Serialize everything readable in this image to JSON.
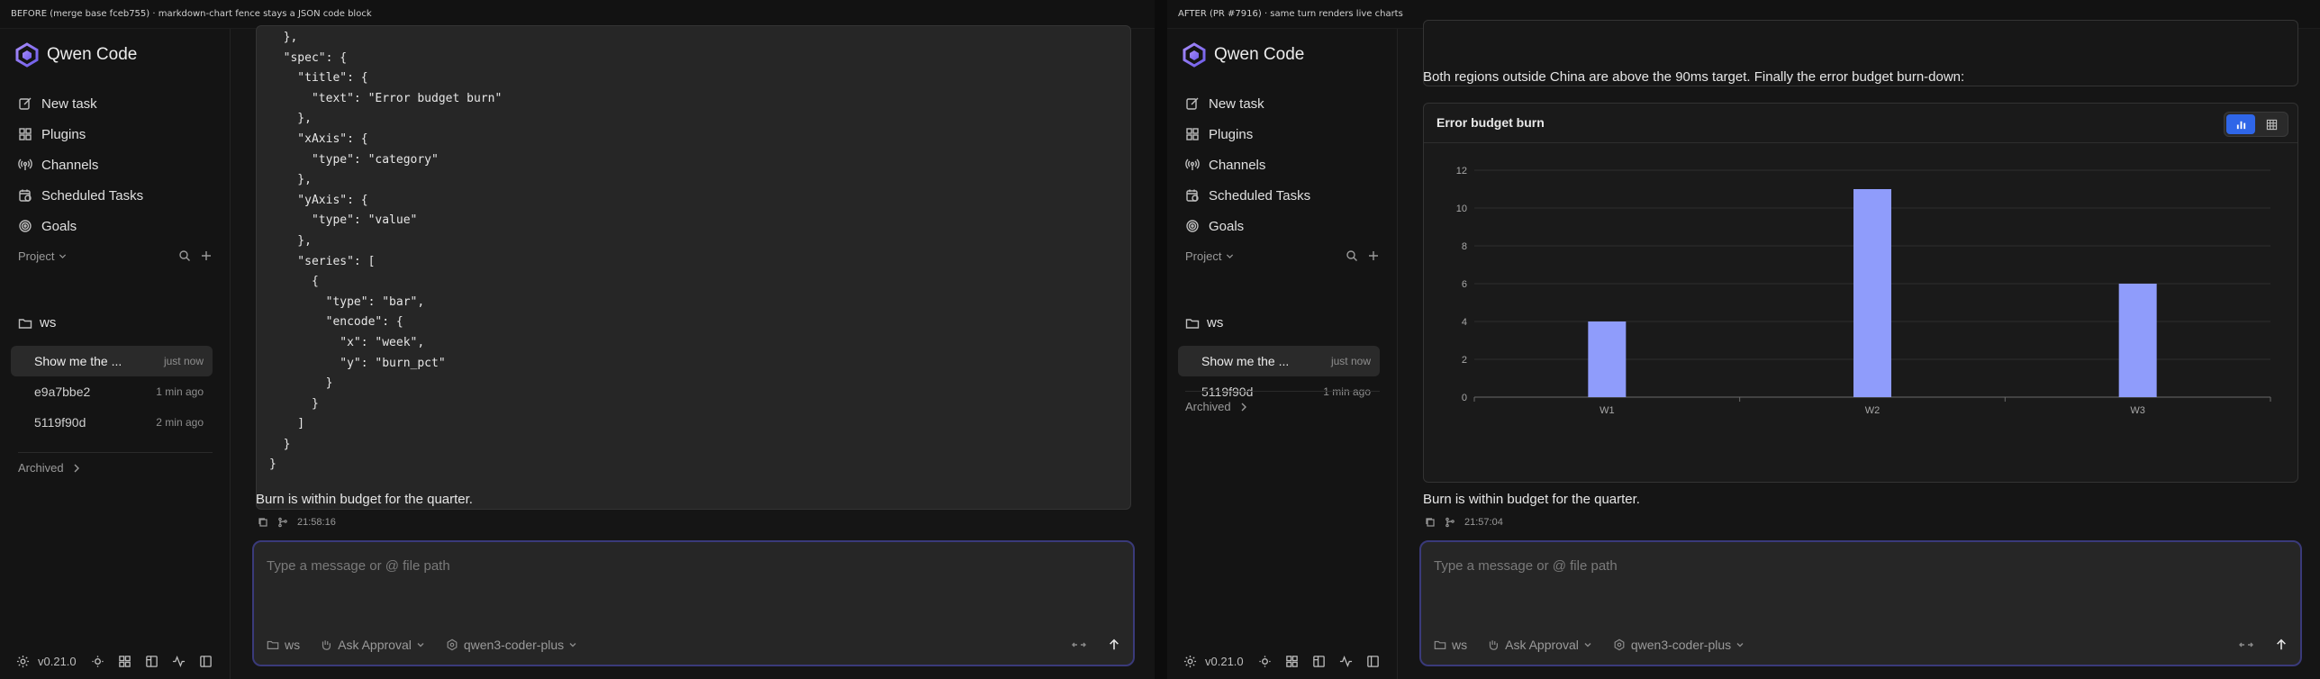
{
  "panels": {
    "left": {
      "caption": "BEFORE (merge base fceb755) · markdown-chart fence stays a JSON code block",
      "sessions": [
        {
          "title": "Show me the ...",
          "time": "just now",
          "active": true
        },
        {
          "title": "e9a7bbe2",
          "time": "1 min ago",
          "active": false
        },
        {
          "title": "5119f90d",
          "time": "2 min ago",
          "active": false
        }
      ],
      "code_lines": [
        "  },",
        "  \"spec\": {",
        "    \"title\": {",
        "      \"text\": \"Error budget burn\"",
        "    },",
        "    \"xAxis\": {",
        "      \"type\": \"category\"",
        "    },",
        "    \"yAxis\": {",
        "      \"type\": \"value\"",
        "    },",
        "    \"series\": [",
        "      {",
        "        \"type\": \"bar\",",
        "        \"encode\": {",
        "          \"x\": \"week\",",
        "          \"y\": \"burn_pct\"",
        "        }",
        "      }",
        "    ]",
        "  }",
        "}"
      ],
      "message": "Burn is within budget for the quarter.",
      "timestamp": "21:58:16"
    },
    "right": {
      "caption": "AFTER (PR #7916) · same turn renders live charts",
      "sessions": [
        {
          "title": "Show me the ...",
          "time": "just now",
          "active": true
        },
        {
          "title": "5119f90d",
          "time": "1 min ago",
          "active": false
        }
      ],
      "intro": "Both regions outside China are above the 90ms target. Finally the error budget burn-down:",
      "message": "Burn is within budget for the quarter.",
      "timestamp": "21:57:04"
    }
  },
  "sidebar": {
    "brand": "Qwen Code",
    "nav": {
      "new_task": "New task",
      "plugins": "Plugins",
      "channels": "Channels",
      "scheduled": "Scheduled Tasks",
      "goals": "Goals"
    },
    "project_label": "Project",
    "workspace": "ws",
    "archived_label": "Archived",
    "version": "v0.21.0"
  },
  "composer": {
    "placeholder": "Type a message or @ file path",
    "workspace": "ws",
    "approval": "Ask Approval",
    "model": "qwen3-coder-plus"
  },
  "colors": {
    "bar": "#8f9cfb",
    "accent": "#2f66e8",
    "composer_border": "#3a3a7a"
  },
  "chart_data": {
    "type": "bar",
    "title": "Error budget burn",
    "categories": [
      "W1",
      "W2",
      "W3"
    ],
    "values": [
      4,
      11,
      6
    ],
    "ylim": [
      0,
      12
    ],
    "yticks": [
      0,
      2,
      4,
      6,
      8,
      10,
      12
    ],
    "grid": true
  }
}
